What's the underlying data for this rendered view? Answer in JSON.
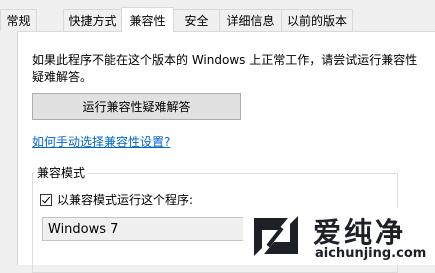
{
  "tabs": [
    {
      "label": "常规",
      "active": false
    },
    {
      "label": "快捷方式",
      "active": false
    },
    {
      "label": "兼容性",
      "active": true
    },
    {
      "label": "安全",
      "active": false
    },
    {
      "label": "详细信息",
      "active": false
    },
    {
      "label": "以前的版本",
      "active": false
    }
  ],
  "compat": {
    "description": "如果此程序不能在这个版本的 Windows 上正常工作，请尝试运行兼容性疑难解答。",
    "troubleshoot_button": "运行兼容性疑难解答",
    "manual_link": "如何手动选择兼容性设置?",
    "mode_group_title": "兼容模式",
    "mode_checkbox_label": "以兼容模式运行这个程序:",
    "mode_checked": true,
    "os_selected": "Windows 7"
  },
  "watermark": {
    "logo_text": "爱纯净",
    "url": "aichunjing.com",
    "icon": "aichunjing-logo-icon",
    "color": "#1d2026"
  }
}
